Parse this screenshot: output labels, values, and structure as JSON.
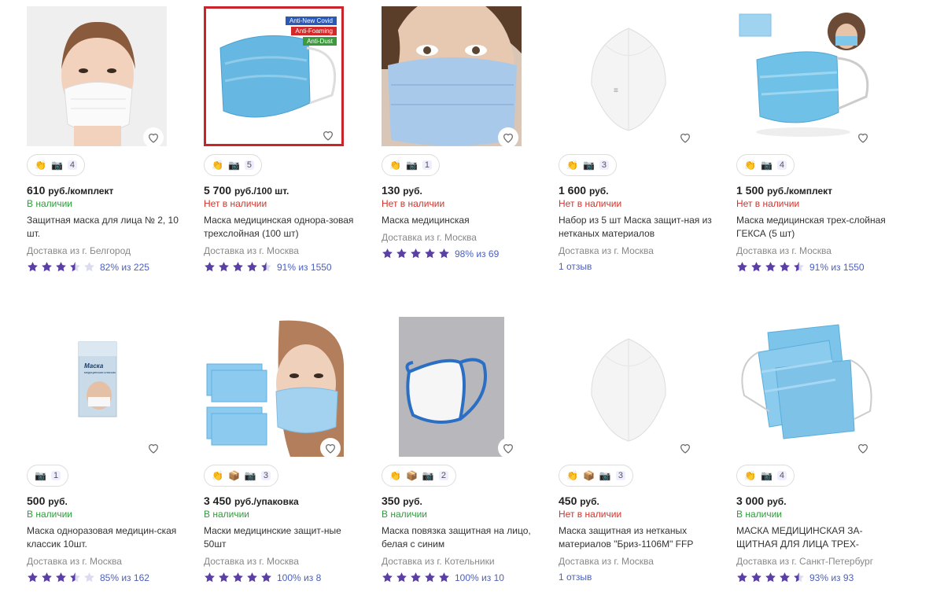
{
  "colors": {
    "star_fill": "#5a3fa6",
    "star_empty": "#dcdcf0",
    "in_stock": "#2e9c3a",
    "out_of_stock": "#d0342c",
    "link": "#4a5fc1"
  },
  "products": [
    {
      "price": "610",
      "unit": "руб./комплект",
      "stock": "В наличии",
      "title": "Защитная маска для лица № 2, 10 шт.",
      "delivery": "Доставка из г. Белгород",
      "rating_text": "82% из 225",
      "rating_stars": 3.5,
      "badges": [
        "👏",
        "📷"
      ],
      "photo_count": "4"
    },
    {
      "price": "5 700",
      "unit": "руб./100 шт.",
      "stock": "Нет в наличии",
      "title": "Маска медицинская однора-зовая трехслойная (100 шт)",
      "delivery": "Доставка из г. Москва",
      "rating_text": "91% из 1550",
      "rating_stars": 4.5,
      "badges": [
        "👏",
        "📷"
      ],
      "photo_count": "5",
      "label_lines": [
        "Anti-New Covid",
        "Anti-Foaming",
        "Anti-Dust"
      ]
    },
    {
      "price": "130",
      "unit": "руб.",
      "stock": "Нет в наличии",
      "title": "Маска медицинская",
      "delivery": "Доставка из г. Москва",
      "rating_text": "98% из 69",
      "rating_stars": 5,
      "badges": [
        "👏",
        "📷"
      ],
      "photo_count": "1"
    },
    {
      "price": "1 600",
      "unit": "руб.",
      "stock": "Нет в наличии",
      "title": "Набор из 5 шт Маска защит-ная из нетканых материалов",
      "delivery": "Доставка из г. Москва",
      "rating_text": "1 отзыв",
      "rating_stars": 0,
      "badges": [
        "👏",
        "📷"
      ],
      "photo_count": "3"
    },
    {
      "price": "1 500",
      "unit": "руб./комплект",
      "stock": "Нет в наличии",
      "title": "Маска медицинская трех-слойная ГЕКСА (5 шт)",
      "delivery": "Доставка из г. Москва",
      "rating_text": "91% из 1550",
      "rating_stars": 4.5,
      "badges": [
        "👏",
        "📷"
      ],
      "photo_count": "4"
    },
    {
      "price": "500",
      "unit": "руб.",
      "stock": "В наличии",
      "title": "Маска одноразовая медицин-ская классик 10шт.",
      "delivery": "Доставка из г. Москва",
      "rating_text": "85% из 162",
      "rating_stars": 3.5,
      "badges": [
        "📷"
      ],
      "photo_count": "1",
      "package_title": "Маска",
      "package_subtitle": "медицинская классик"
    },
    {
      "price": "3 450",
      "unit": "руб./упаковка",
      "stock": "В наличии",
      "title": "Маски медицинские защит-ные 50шт",
      "delivery": "Доставка из г. Москва",
      "rating_text": "100% из 8",
      "rating_stars": 5,
      "badges": [
        "👏",
        "📦",
        "📷"
      ],
      "photo_count": "3"
    },
    {
      "price": "350",
      "unit": "руб.",
      "stock": "В наличии",
      "title": "Маска повязка защитная на лицо, белая с синим",
      "delivery": "Доставка из г. Котельники",
      "rating_text": "100% из 10",
      "rating_stars": 5,
      "badges": [
        "👏",
        "📦",
        "📷"
      ],
      "photo_count": "2"
    },
    {
      "price": "450",
      "unit": "руб.",
      "stock": "Нет в наличии",
      "title": "Маска защитная из нетканых материалов \"Бриз-1106М\" FFP",
      "delivery": "Доставка из г. Москва",
      "rating_text": "1 отзыв",
      "rating_stars": 0,
      "badges": [
        "👏",
        "📦",
        "📷"
      ],
      "photo_count": "3"
    },
    {
      "price": "3 000",
      "unit": "руб.",
      "stock": "В наличии",
      "title": "МАСКА МЕДИЦИНСКАЯ ЗА-ЩИТНАЯ ДЛЯ ЛИЦА ТРЕХ-",
      "delivery": "Доставка из г. Санкт-Петербург",
      "rating_text": "93% из 93",
      "rating_stars": 4.5,
      "badges": [
        "👏",
        "📷"
      ],
      "photo_count": "4"
    }
  ]
}
